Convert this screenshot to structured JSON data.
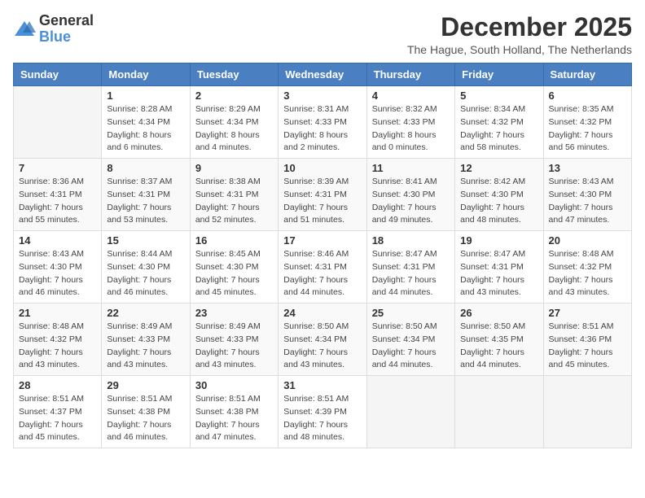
{
  "logo": {
    "general": "General",
    "blue": "Blue"
  },
  "title": "December 2025",
  "subtitle": "The Hague, South Holland, The Netherlands",
  "days_of_week": [
    "Sunday",
    "Monday",
    "Tuesday",
    "Wednesday",
    "Thursday",
    "Friday",
    "Saturday"
  ],
  "weeks": [
    [
      {
        "day": "",
        "sunrise": "",
        "sunset": "",
        "daylight": ""
      },
      {
        "day": "1",
        "sunrise": "Sunrise: 8:28 AM",
        "sunset": "Sunset: 4:34 PM",
        "daylight": "Daylight: 8 hours and 6 minutes."
      },
      {
        "day": "2",
        "sunrise": "Sunrise: 8:29 AM",
        "sunset": "Sunset: 4:34 PM",
        "daylight": "Daylight: 8 hours and 4 minutes."
      },
      {
        "day": "3",
        "sunrise": "Sunrise: 8:31 AM",
        "sunset": "Sunset: 4:33 PM",
        "daylight": "Daylight: 8 hours and 2 minutes."
      },
      {
        "day": "4",
        "sunrise": "Sunrise: 8:32 AM",
        "sunset": "Sunset: 4:33 PM",
        "daylight": "Daylight: 8 hours and 0 minutes."
      },
      {
        "day": "5",
        "sunrise": "Sunrise: 8:34 AM",
        "sunset": "Sunset: 4:32 PM",
        "daylight": "Daylight: 7 hours and 58 minutes."
      },
      {
        "day": "6",
        "sunrise": "Sunrise: 8:35 AM",
        "sunset": "Sunset: 4:32 PM",
        "daylight": "Daylight: 7 hours and 56 minutes."
      }
    ],
    [
      {
        "day": "7",
        "sunrise": "Sunrise: 8:36 AM",
        "sunset": "Sunset: 4:31 PM",
        "daylight": "Daylight: 7 hours and 55 minutes."
      },
      {
        "day": "8",
        "sunrise": "Sunrise: 8:37 AM",
        "sunset": "Sunset: 4:31 PM",
        "daylight": "Daylight: 7 hours and 53 minutes."
      },
      {
        "day": "9",
        "sunrise": "Sunrise: 8:38 AM",
        "sunset": "Sunset: 4:31 PM",
        "daylight": "Daylight: 7 hours and 52 minutes."
      },
      {
        "day": "10",
        "sunrise": "Sunrise: 8:39 AM",
        "sunset": "Sunset: 4:31 PM",
        "daylight": "Daylight: 7 hours and 51 minutes."
      },
      {
        "day": "11",
        "sunrise": "Sunrise: 8:41 AM",
        "sunset": "Sunset: 4:30 PM",
        "daylight": "Daylight: 7 hours and 49 minutes."
      },
      {
        "day": "12",
        "sunrise": "Sunrise: 8:42 AM",
        "sunset": "Sunset: 4:30 PM",
        "daylight": "Daylight: 7 hours and 48 minutes."
      },
      {
        "day": "13",
        "sunrise": "Sunrise: 8:43 AM",
        "sunset": "Sunset: 4:30 PM",
        "daylight": "Daylight: 7 hours and 47 minutes."
      }
    ],
    [
      {
        "day": "14",
        "sunrise": "Sunrise: 8:43 AM",
        "sunset": "Sunset: 4:30 PM",
        "daylight": "Daylight: 7 hours and 46 minutes."
      },
      {
        "day": "15",
        "sunrise": "Sunrise: 8:44 AM",
        "sunset": "Sunset: 4:30 PM",
        "daylight": "Daylight: 7 hours and 46 minutes."
      },
      {
        "day": "16",
        "sunrise": "Sunrise: 8:45 AM",
        "sunset": "Sunset: 4:30 PM",
        "daylight": "Daylight: 7 hours and 45 minutes."
      },
      {
        "day": "17",
        "sunrise": "Sunrise: 8:46 AM",
        "sunset": "Sunset: 4:31 PM",
        "daylight": "Daylight: 7 hours and 44 minutes."
      },
      {
        "day": "18",
        "sunrise": "Sunrise: 8:47 AM",
        "sunset": "Sunset: 4:31 PM",
        "daylight": "Daylight: 7 hours and 44 minutes."
      },
      {
        "day": "19",
        "sunrise": "Sunrise: 8:47 AM",
        "sunset": "Sunset: 4:31 PM",
        "daylight": "Daylight: 7 hours and 43 minutes."
      },
      {
        "day": "20",
        "sunrise": "Sunrise: 8:48 AM",
        "sunset": "Sunset: 4:32 PM",
        "daylight": "Daylight: 7 hours and 43 minutes."
      }
    ],
    [
      {
        "day": "21",
        "sunrise": "Sunrise: 8:48 AM",
        "sunset": "Sunset: 4:32 PM",
        "daylight": "Daylight: 7 hours and 43 minutes."
      },
      {
        "day": "22",
        "sunrise": "Sunrise: 8:49 AM",
        "sunset": "Sunset: 4:33 PM",
        "daylight": "Daylight: 7 hours and 43 minutes."
      },
      {
        "day": "23",
        "sunrise": "Sunrise: 8:49 AM",
        "sunset": "Sunset: 4:33 PM",
        "daylight": "Daylight: 7 hours and 43 minutes."
      },
      {
        "day": "24",
        "sunrise": "Sunrise: 8:50 AM",
        "sunset": "Sunset: 4:34 PM",
        "daylight": "Daylight: 7 hours and 43 minutes."
      },
      {
        "day": "25",
        "sunrise": "Sunrise: 8:50 AM",
        "sunset": "Sunset: 4:34 PM",
        "daylight": "Daylight: 7 hours and 44 minutes."
      },
      {
        "day": "26",
        "sunrise": "Sunrise: 8:50 AM",
        "sunset": "Sunset: 4:35 PM",
        "daylight": "Daylight: 7 hours and 44 minutes."
      },
      {
        "day": "27",
        "sunrise": "Sunrise: 8:51 AM",
        "sunset": "Sunset: 4:36 PM",
        "daylight": "Daylight: 7 hours and 45 minutes."
      }
    ],
    [
      {
        "day": "28",
        "sunrise": "Sunrise: 8:51 AM",
        "sunset": "Sunset: 4:37 PM",
        "daylight": "Daylight: 7 hours and 45 minutes."
      },
      {
        "day": "29",
        "sunrise": "Sunrise: 8:51 AM",
        "sunset": "Sunset: 4:38 PM",
        "daylight": "Daylight: 7 hours and 46 minutes."
      },
      {
        "day": "30",
        "sunrise": "Sunrise: 8:51 AM",
        "sunset": "Sunset: 4:38 PM",
        "daylight": "Daylight: 7 hours and 47 minutes."
      },
      {
        "day": "31",
        "sunrise": "Sunrise: 8:51 AM",
        "sunset": "Sunset: 4:39 PM",
        "daylight": "Daylight: 7 hours and 48 minutes."
      },
      {
        "day": "",
        "sunrise": "",
        "sunset": "",
        "daylight": ""
      },
      {
        "day": "",
        "sunrise": "",
        "sunset": "",
        "daylight": ""
      },
      {
        "day": "",
        "sunrise": "",
        "sunset": "",
        "daylight": ""
      }
    ]
  ]
}
